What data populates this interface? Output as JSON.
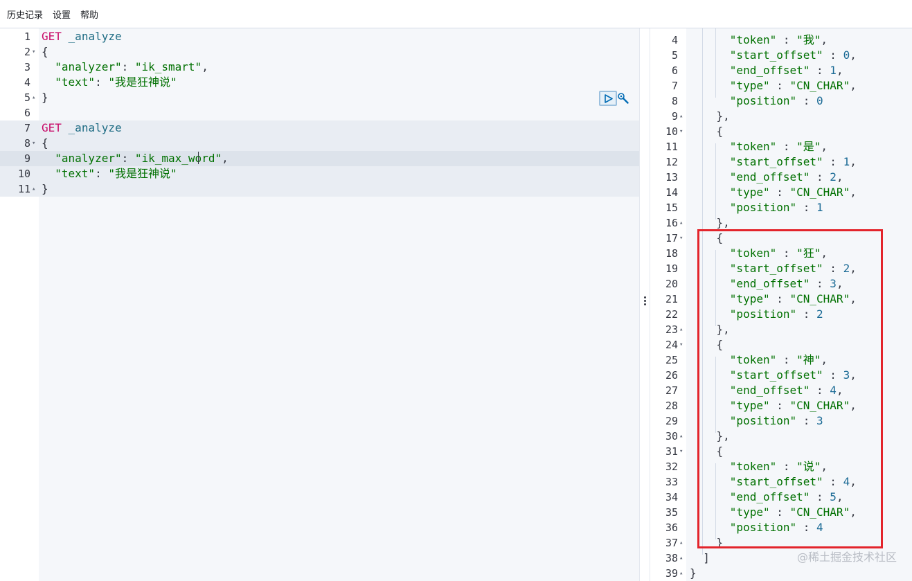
{
  "menu": {
    "history": "历史记录",
    "settings": "设置",
    "help": "帮助"
  },
  "request_editor": {
    "lines": [
      {
        "num": "1",
        "fold": "",
        "tokens": [
          {
            "t": "GET",
            "c": "kw"
          },
          {
            "t": " ",
            "c": "pun"
          },
          {
            "t": "_analyze",
            "c": "path"
          }
        ]
      },
      {
        "num": "2",
        "fold": "▾",
        "tokens": [
          {
            "t": "{",
            "c": "pun"
          }
        ]
      },
      {
        "num": "3",
        "fold": "",
        "tokens": [
          {
            "t": "  ",
            "c": "pun"
          },
          {
            "t": "\"analyzer\"",
            "c": "str"
          },
          {
            "t": ": ",
            "c": "pun"
          },
          {
            "t": "\"ik_smart\"",
            "c": "str"
          },
          {
            "t": ",",
            "c": "pun"
          }
        ]
      },
      {
        "num": "4",
        "fold": "",
        "tokens": [
          {
            "t": "  ",
            "c": "pun"
          },
          {
            "t": "\"text\"",
            "c": "str"
          },
          {
            "t": ": ",
            "c": "pun"
          },
          {
            "t": "\"我是狂神说\"",
            "c": "str"
          }
        ]
      },
      {
        "num": "5",
        "fold": "▴",
        "tokens": [
          {
            "t": "}",
            "c": "pun"
          }
        ]
      },
      {
        "num": "6",
        "fold": "",
        "tokens": []
      },
      {
        "num": "7",
        "fold": "",
        "tokens": [
          {
            "t": "GET",
            "c": "kw"
          },
          {
            "t": " ",
            "c": "pun"
          },
          {
            "t": "_analyze",
            "c": "path"
          }
        ]
      },
      {
        "num": "8",
        "fold": "▾",
        "tokens": [
          {
            "t": "{",
            "c": "pun"
          }
        ]
      },
      {
        "num": "9",
        "fold": "",
        "tokens": [
          {
            "t": "  ",
            "c": "pun"
          },
          {
            "t": "\"analyzer\"",
            "c": "str"
          },
          {
            "t": ": ",
            "c": "pun"
          },
          {
            "t": "\"ik_max_word\"",
            "c": "str"
          },
          {
            "t": ",",
            "c": "pun"
          }
        ]
      },
      {
        "num": "10",
        "fold": "",
        "tokens": [
          {
            "t": "  ",
            "c": "pun"
          },
          {
            "t": "\"text\"",
            "c": "str"
          },
          {
            "t": ": ",
            "c": "pun"
          },
          {
            "t": "\"我是狂神说\"",
            "c": "str"
          }
        ]
      },
      {
        "num": "11",
        "fold": "▴",
        "tokens": [
          {
            "t": "}",
            "c": "pun"
          }
        ]
      }
    ]
  },
  "response_viewer": {
    "lines": [
      {
        "num": "4",
        "fold": "",
        "tokens": [
          {
            "t": "      ",
            "c": "pun"
          },
          {
            "t": "\"token\"",
            "c": "str"
          },
          {
            "t": " : ",
            "c": "pun"
          },
          {
            "t": "\"我\"",
            "c": "str"
          },
          {
            "t": ",",
            "c": "pun"
          }
        ]
      },
      {
        "num": "5",
        "fold": "",
        "tokens": [
          {
            "t": "      ",
            "c": "pun"
          },
          {
            "t": "\"start_offset\"",
            "c": "str"
          },
          {
            "t": " : ",
            "c": "pun"
          },
          {
            "t": "0",
            "c": "num"
          },
          {
            "t": ",",
            "c": "pun"
          }
        ]
      },
      {
        "num": "6",
        "fold": "",
        "tokens": [
          {
            "t": "      ",
            "c": "pun"
          },
          {
            "t": "\"end_offset\"",
            "c": "str"
          },
          {
            "t": " : ",
            "c": "pun"
          },
          {
            "t": "1",
            "c": "num"
          },
          {
            "t": ",",
            "c": "pun"
          }
        ]
      },
      {
        "num": "7",
        "fold": "",
        "tokens": [
          {
            "t": "      ",
            "c": "pun"
          },
          {
            "t": "\"type\"",
            "c": "str"
          },
          {
            "t": " : ",
            "c": "pun"
          },
          {
            "t": "\"CN_CHAR\"",
            "c": "str"
          },
          {
            "t": ",",
            "c": "pun"
          }
        ]
      },
      {
        "num": "8",
        "fold": "",
        "tokens": [
          {
            "t": "      ",
            "c": "pun"
          },
          {
            "t": "\"position\"",
            "c": "str"
          },
          {
            "t": " : ",
            "c": "pun"
          },
          {
            "t": "0",
            "c": "num"
          }
        ]
      },
      {
        "num": "9",
        "fold": "▴",
        "tokens": [
          {
            "t": "    },",
            "c": "pun"
          }
        ]
      },
      {
        "num": "10",
        "fold": "▾",
        "tokens": [
          {
            "t": "    {",
            "c": "pun"
          }
        ]
      },
      {
        "num": "11",
        "fold": "",
        "tokens": [
          {
            "t": "      ",
            "c": "pun"
          },
          {
            "t": "\"token\"",
            "c": "str"
          },
          {
            "t": " : ",
            "c": "pun"
          },
          {
            "t": "\"是\"",
            "c": "str"
          },
          {
            "t": ",",
            "c": "pun"
          }
        ]
      },
      {
        "num": "12",
        "fold": "",
        "tokens": [
          {
            "t": "      ",
            "c": "pun"
          },
          {
            "t": "\"start_offset\"",
            "c": "str"
          },
          {
            "t": " : ",
            "c": "pun"
          },
          {
            "t": "1",
            "c": "num"
          },
          {
            "t": ",",
            "c": "pun"
          }
        ]
      },
      {
        "num": "13",
        "fold": "",
        "tokens": [
          {
            "t": "      ",
            "c": "pun"
          },
          {
            "t": "\"end_offset\"",
            "c": "str"
          },
          {
            "t": " : ",
            "c": "pun"
          },
          {
            "t": "2",
            "c": "num"
          },
          {
            "t": ",",
            "c": "pun"
          }
        ]
      },
      {
        "num": "14",
        "fold": "",
        "tokens": [
          {
            "t": "      ",
            "c": "pun"
          },
          {
            "t": "\"type\"",
            "c": "str"
          },
          {
            "t": " : ",
            "c": "pun"
          },
          {
            "t": "\"CN_CHAR\"",
            "c": "str"
          },
          {
            "t": ",",
            "c": "pun"
          }
        ]
      },
      {
        "num": "15",
        "fold": "",
        "tokens": [
          {
            "t": "      ",
            "c": "pun"
          },
          {
            "t": "\"position\"",
            "c": "str"
          },
          {
            "t": " : ",
            "c": "pun"
          },
          {
            "t": "1",
            "c": "num"
          }
        ]
      },
      {
        "num": "16",
        "fold": "▴",
        "tokens": [
          {
            "t": "    },",
            "c": "pun"
          }
        ]
      },
      {
        "num": "17",
        "fold": "▾",
        "tokens": [
          {
            "t": "    {",
            "c": "pun"
          }
        ]
      },
      {
        "num": "18",
        "fold": "",
        "tokens": [
          {
            "t": "      ",
            "c": "pun"
          },
          {
            "t": "\"token\"",
            "c": "str"
          },
          {
            "t": " : ",
            "c": "pun"
          },
          {
            "t": "\"狂\"",
            "c": "str"
          },
          {
            "t": ",",
            "c": "pun"
          }
        ]
      },
      {
        "num": "19",
        "fold": "",
        "tokens": [
          {
            "t": "      ",
            "c": "pun"
          },
          {
            "t": "\"start_offset\"",
            "c": "str"
          },
          {
            "t": " : ",
            "c": "pun"
          },
          {
            "t": "2",
            "c": "num"
          },
          {
            "t": ",",
            "c": "pun"
          }
        ]
      },
      {
        "num": "20",
        "fold": "",
        "tokens": [
          {
            "t": "      ",
            "c": "pun"
          },
          {
            "t": "\"end_offset\"",
            "c": "str"
          },
          {
            "t": " : ",
            "c": "pun"
          },
          {
            "t": "3",
            "c": "num"
          },
          {
            "t": ",",
            "c": "pun"
          }
        ]
      },
      {
        "num": "21",
        "fold": "",
        "tokens": [
          {
            "t": "      ",
            "c": "pun"
          },
          {
            "t": "\"type\"",
            "c": "str"
          },
          {
            "t": " : ",
            "c": "pun"
          },
          {
            "t": "\"CN_CHAR\"",
            "c": "str"
          },
          {
            "t": ",",
            "c": "pun"
          }
        ]
      },
      {
        "num": "22",
        "fold": "",
        "tokens": [
          {
            "t": "      ",
            "c": "pun"
          },
          {
            "t": "\"position\"",
            "c": "str"
          },
          {
            "t": " : ",
            "c": "pun"
          },
          {
            "t": "2",
            "c": "num"
          }
        ]
      },
      {
        "num": "23",
        "fold": "▴",
        "tokens": [
          {
            "t": "    },",
            "c": "pun"
          }
        ]
      },
      {
        "num": "24",
        "fold": "▾",
        "tokens": [
          {
            "t": "    {",
            "c": "pun"
          }
        ]
      },
      {
        "num": "25",
        "fold": "",
        "tokens": [
          {
            "t": "      ",
            "c": "pun"
          },
          {
            "t": "\"token\"",
            "c": "str"
          },
          {
            "t": " : ",
            "c": "pun"
          },
          {
            "t": "\"神\"",
            "c": "str"
          },
          {
            "t": ",",
            "c": "pun"
          }
        ]
      },
      {
        "num": "26",
        "fold": "",
        "tokens": [
          {
            "t": "      ",
            "c": "pun"
          },
          {
            "t": "\"start_offset\"",
            "c": "str"
          },
          {
            "t": " : ",
            "c": "pun"
          },
          {
            "t": "3",
            "c": "num"
          },
          {
            "t": ",",
            "c": "pun"
          }
        ]
      },
      {
        "num": "27",
        "fold": "",
        "tokens": [
          {
            "t": "      ",
            "c": "pun"
          },
          {
            "t": "\"end_offset\"",
            "c": "str"
          },
          {
            "t": " : ",
            "c": "pun"
          },
          {
            "t": "4",
            "c": "num"
          },
          {
            "t": ",",
            "c": "pun"
          }
        ]
      },
      {
        "num": "28",
        "fold": "",
        "tokens": [
          {
            "t": "      ",
            "c": "pun"
          },
          {
            "t": "\"type\"",
            "c": "str"
          },
          {
            "t": " : ",
            "c": "pun"
          },
          {
            "t": "\"CN_CHAR\"",
            "c": "str"
          },
          {
            "t": ",",
            "c": "pun"
          }
        ]
      },
      {
        "num": "29",
        "fold": "",
        "tokens": [
          {
            "t": "      ",
            "c": "pun"
          },
          {
            "t": "\"position\"",
            "c": "str"
          },
          {
            "t": " : ",
            "c": "pun"
          },
          {
            "t": "3",
            "c": "num"
          }
        ]
      },
      {
        "num": "30",
        "fold": "▴",
        "tokens": [
          {
            "t": "    },",
            "c": "pun"
          }
        ]
      },
      {
        "num": "31",
        "fold": "▾",
        "tokens": [
          {
            "t": "    {",
            "c": "pun"
          }
        ]
      },
      {
        "num": "32",
        "fold": "",
        "tokens": [
          {
            "t": "      ",
            "c": "pun"
          },
          {
            "t": "\"token\"",
            "c": "str"
          },
          {
            "t": " : ",
            "c": "pun"
          },
          {
            "t": "\"说\"",
            "c": "str"
          },
          {
            "t": ",",
            "c": "pun"
          }
        ]
      },
      {
        "num": "33",
        "fold": "",
        "tokens": [
          {
            "t": "      ",
            "c": "pun"
          },
          {
            "t": "\"start_offset\"",
            "c": "str"
          },
          {
            "t": " : ",
            "c": "pun"
          },
          {
            "t": "4",
            "c": "num"
          },
          {
            "t": ",",
            "c": "pun"
          }
        ]
      },
      {
        "num": "34",
        "fold": "",
        "tokens": [
          {
            "t": "      ",
            "c": "pun"
          },
          {
            "t": "\"end_offset\"",
            "c": "str"
          },
          {
            "t": " : ",
            "c": "pun"
          },
          {
            "t": "5",
            "c": "num"
          },
          {
            "t": ",",
            "c": "pun"
          }
        ]
      },
      {
        "num": "35",
        "fold": "",
        "tokens": [
          {
            "t": "      ",
            "c": "pun"
          },
          {
            "t": "\"type\"",
            "c": "str"
          },
          {
            "t": " : ",
            "c": "pun"
          },
          {
            "t": "\"CN_CHAR\"",
            "c": "str"
          },
          {
            "t": ",",
            "c": "pun"
          }
        ]
      },
      {
        "num": "36",
        "fold": "",
        "tokens": [
          {
            "t": "      ",
            "c": "pun"
          },
          {
            "t": "\"position\"",
            "c": "str"
          },
          {
            "t": " : ",
            "c": "pun"
          },
          {
            "t": "4",
            "c": "num"
          }
        ]
      },
      {
        "num": "37",
        "fold": "▴",
        "tokens": [
          {
            "t": "    }",
            "c": "pun"
          }
        ]
      },
      {
        "num": "38",
        "fold": "▴",
        "tokens": [
          {
            "t": "  ]",
            "c": "pun"
          }
        ]
      },
      {
        "num": "39",
        "fold": "▴",
        "tokens": [
          {
            "t": "}",
            "c": "pun"
          }
        ]
      }
    ]
  },
  "icons": {
    "run": "play-icon",
    "settings": "wrench-icon",
    "splitter": "vertical-dots-icon"
  },
  "colors": {
    "highlight_border": "#e3242b",
    "method": "#c80a68",
    "string": "#007000",
    "number": "#1a6a95"
  },
  "watermark": "@稀土掘金技术社区"
}
